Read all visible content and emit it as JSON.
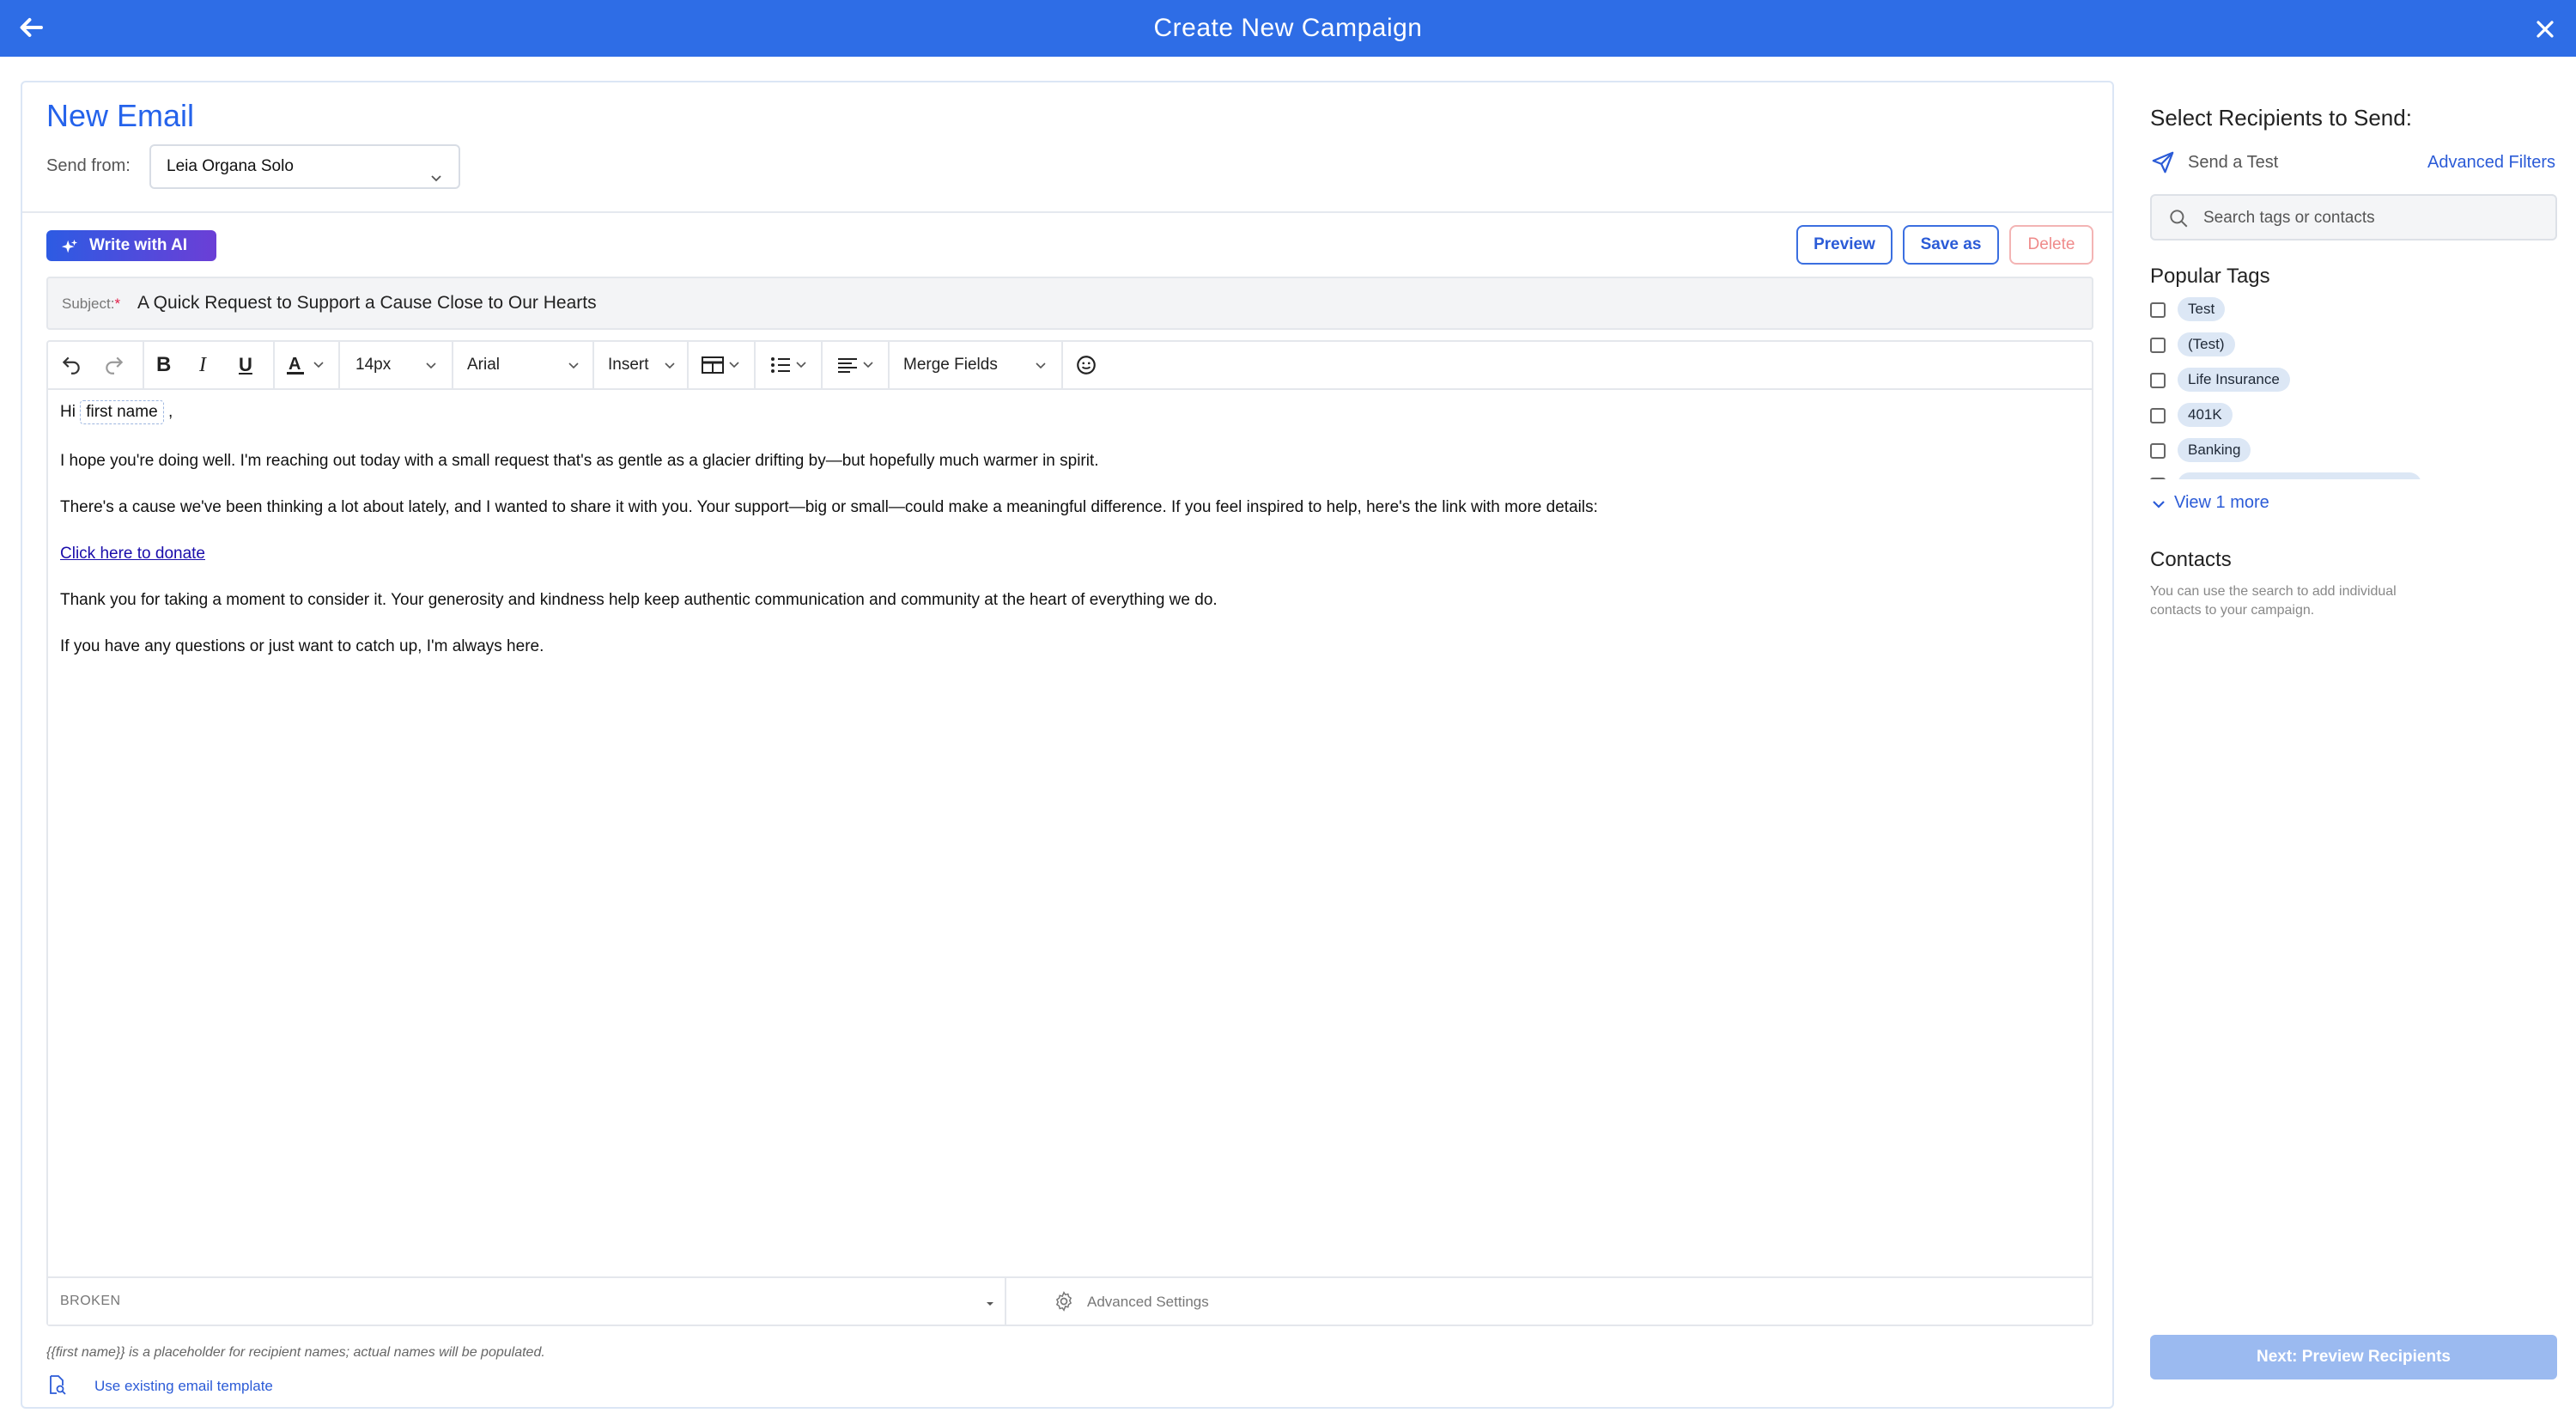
{
  "header": {
    "title": "Create New Campaign",
    "back_icon": "arrow-left-icon",
    "close_icon": "close-icon",
    "color": "#2e6de6"
  },
  "composer": {
    "heading": "New Email",
    "send_from_label": "Send from:",
    "send_from_value": "Leia Organa Solo",
    "write_ai_label": "Write with AI",
    "preview_label": "Preview",
    "save_as_label": "Save as",
    "delete_label": "Delete",
    "subject_label": "Subject:",
    "subject_required": "*",
    "subject_value": "A Quick Request to Support a Cause Close to Our Hearts"
  },
  "toolbar": {
    "font_size": "14px",
    "font_family": "Arial",
    "insert_label": "Insert",
    "merge_fields_label": "Merge Fields"
  },
  "email_body": {
    "greeting": "Hi",
    "merge_tag": "first name",
    "greeting_end": ",",
    "p1": "I hope you're doing well. I'm reaching out today with a small request that's as gentle as a glacier drifting by—but hopefully much warmer in spirit.",
    "p2": "There's a cause we've been thinking a lot about lately, and I wanted to share it with you. Your support—big or small—could make a meaningful difference. If you feel inspired to help, here's the link with more details:",
    "link": "Click here to donate",
    "p3": "Thank you for taking a moment to consider it. Your generosity and kindness help keep authentic communication and community at the heart of everything we do.",
    "p4": "If you have any questions or just want to catch up, I'm always here."
  },
  "editor_footer": {
    "status": "BROKEN",
    "advanced_settings": "Advanced Settings"
  },
  "notes": {
    "placeholder_note": "{{first name}} is a placeholder for recipient names; actual names will be populated.",
    "use_template": "Use existing email template"
  },
  "recipients": {
    "title": "Select Recipients to Send:",
    "send_test": "Send a Test",
    "advanced_filters": "Advanced Filters",
    "search_placeholder": "Search tags or contacts",
    "popular_tags_title": "Popular Tags",
    "tags": [
      "Test",
      "(Test)",
      "Life Insurance",
      "401K",
      "Banking"
    ],
    "view_more": "View 1 more",
    "contacts_title": "Contacts",
    "contacts_desc": "You can use the search to add individual contacts to your campaign.",
    "next_button": "Next: Preview Recipients",
    "next_button_color": "#9bbaf0"
  }
}
